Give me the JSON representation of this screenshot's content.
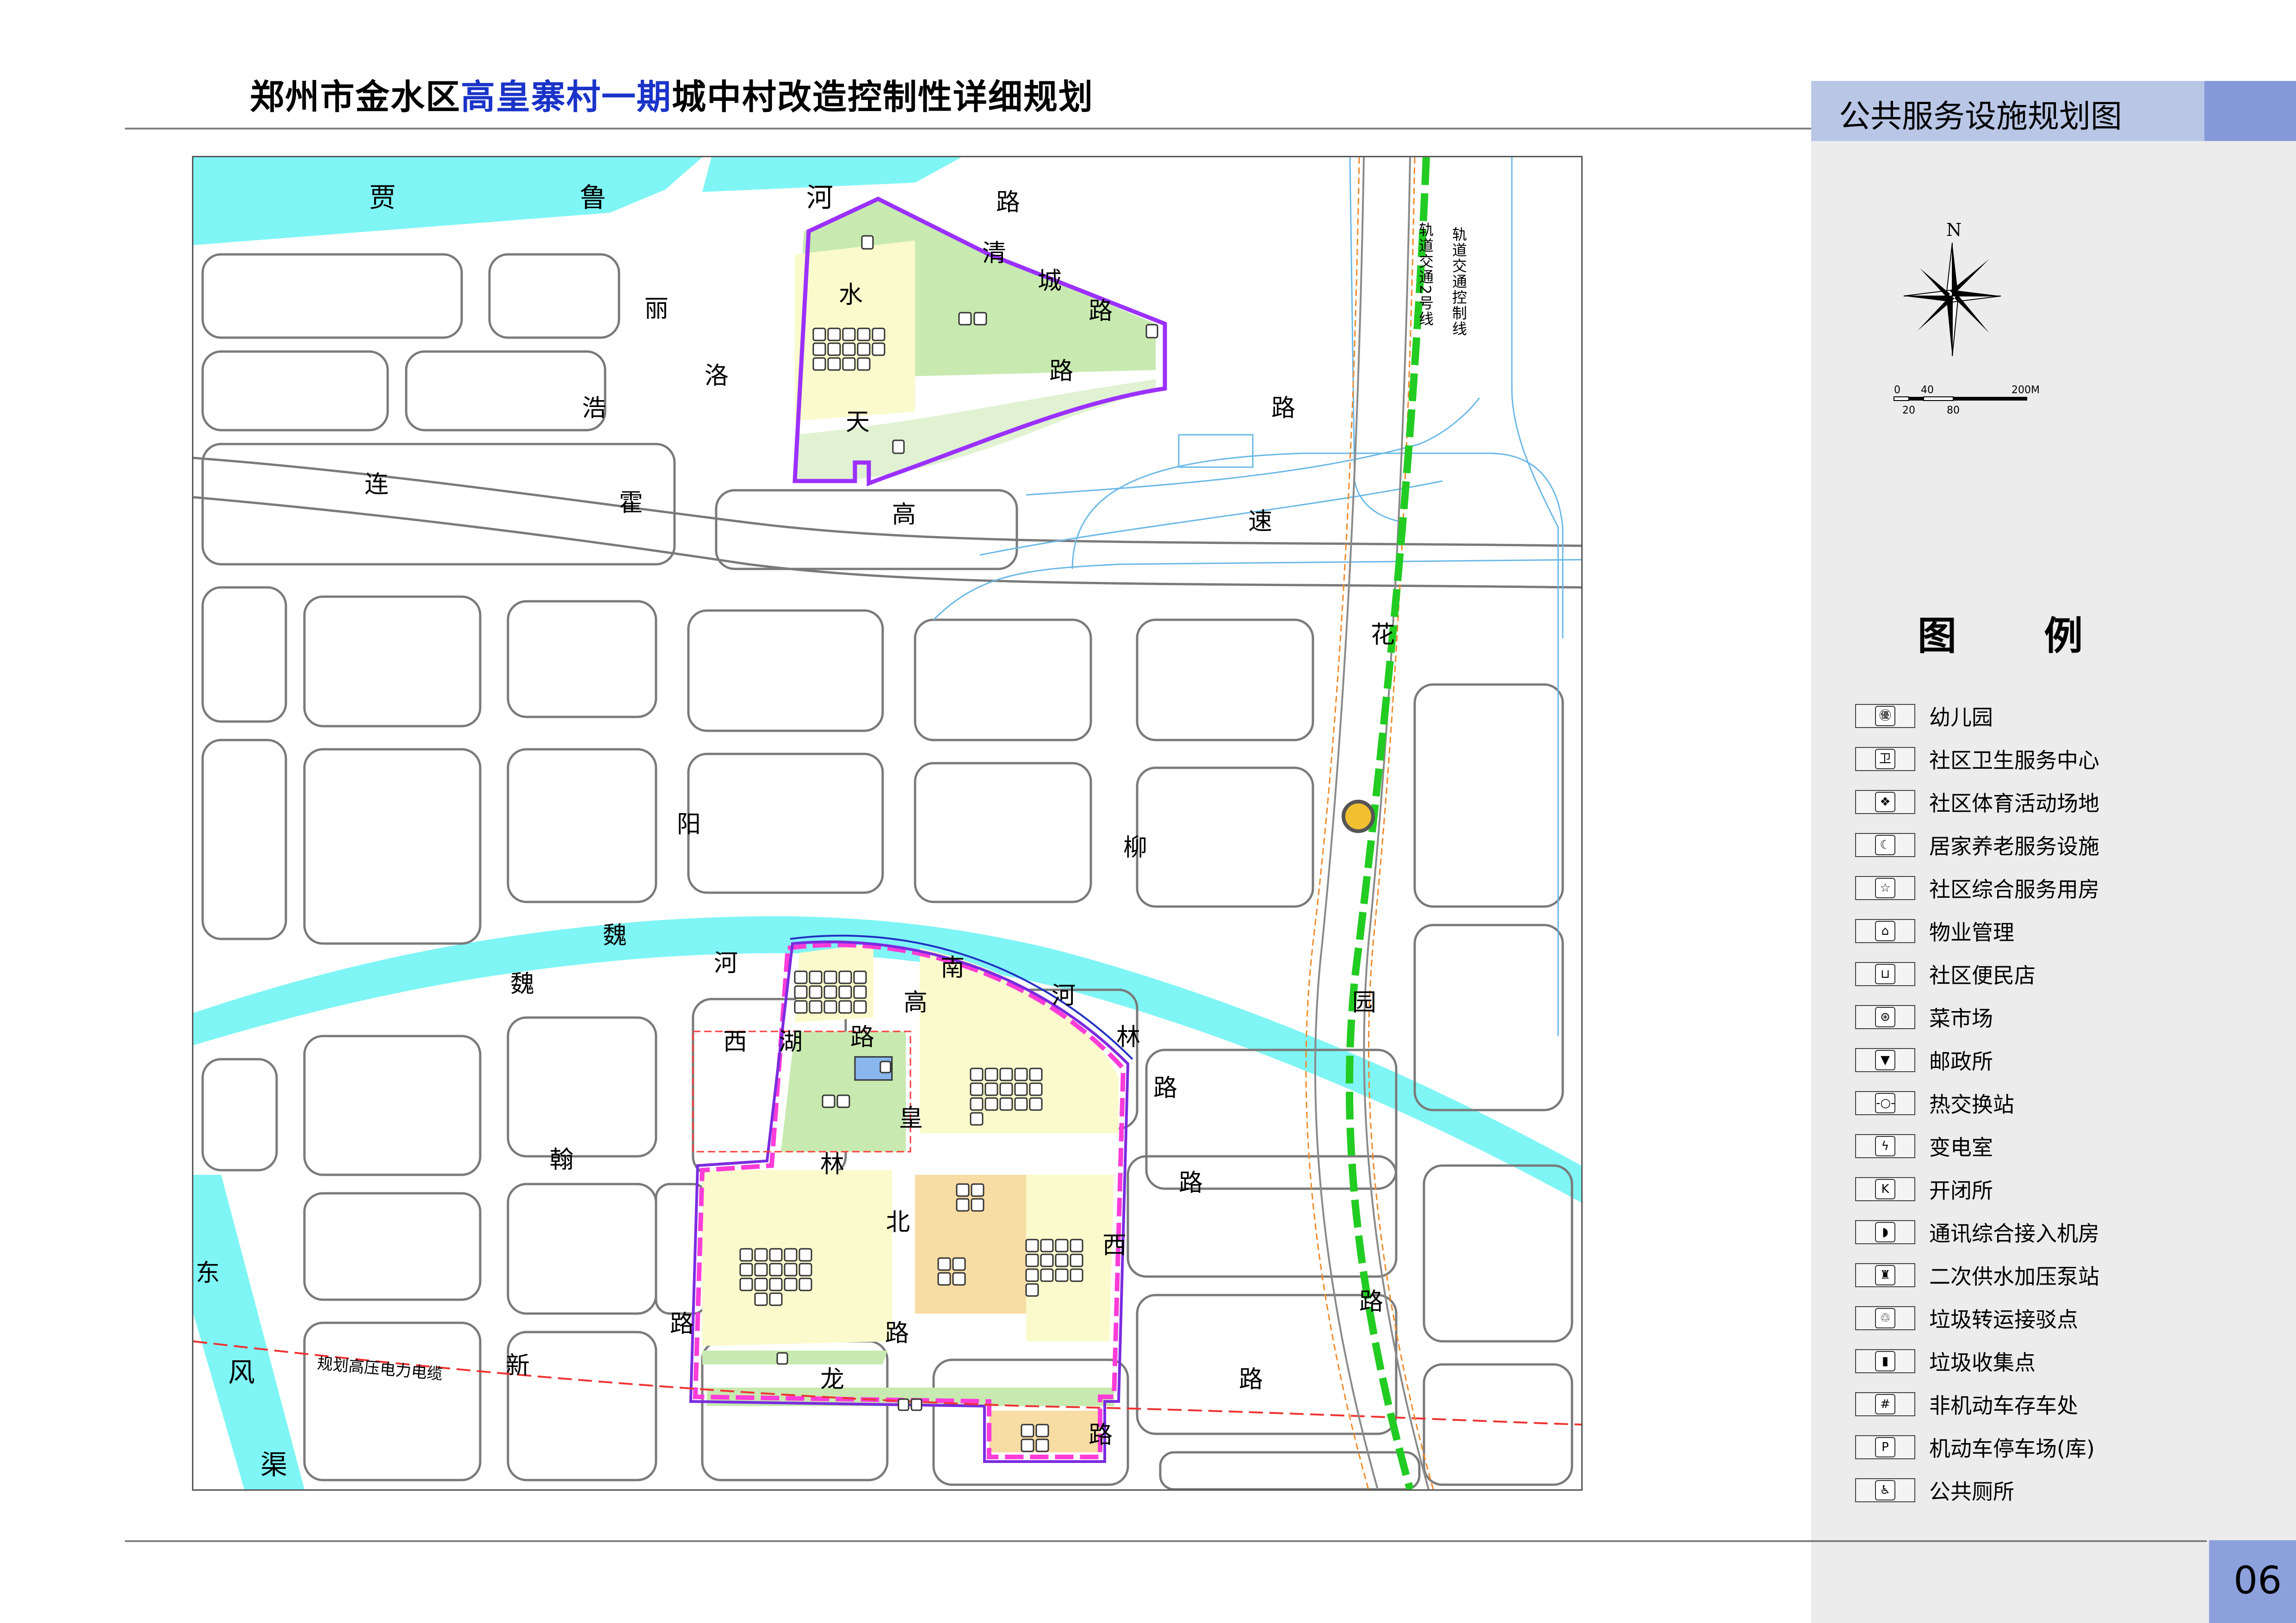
{
  "title": {
    "part1": "郑州市金水区",
    "part2": "高皇寨村一期",
    "part3": "城中村改造控制性详细规划"
  },
  "panel_title": "公共服务设施规划图",
  "page_number": "06",
  "compass": {
    "north": "N"
  },
  "scale": {
    "top": [
      "0",
      "40",
      "200M"
    ],
    "bottom": [
      "20",
      "80"
    ]
  },
  "legend": {
    "title": "图 例",
    "items": [
      {
        "icon": "㊝",
        "label": "幼儿园"
      },
      {
        "icon": "卫",
        "label": "社区卫生服务中心"
      },
      {
        "icon": "❖",
        "label": "社区体育活动场地"
      },
      {
        "icon": "☾",
        "label": "居家养老服务设施"
      },
      {
        "icon": "☆",
        "label": "社区综合服务用房"
      },
      {
        "icon": "⌂",
        "label": "物业管理"
      },
      {
        "icon": "⊔",
        "label": "社区便民店"
      },
      {
        "icon": "⊛",
        "label": "菜市场"
      },
      {
        "icon": "▼",
        "label": "邮政所"
      },
      {
        "icon": "-○-",
        "label": "热交换站"
      },
      {
        "icon": "ϟ",
        "label": "变电室"
      },
      {
        "icon": "K",
        "label": "开闭所"
      },
      {
        "icon": "◗",
        "label": "通讯综合接入机房"
      },
      {
        "icon": "♜",
        "label": "二次供水加压泵站"
      },
      {
        "icon": "♲",
        "label": "垃圾转运接驳点"
      },
      {
        "icon": "▮",
        "label": "垃圾收集点"
      },
      {
        "icon": "#",
        "label": "非机动车存车处"
      },
      {
        "icon": "P",
        "label": "机动车停车场(库)"
      },
      {
        "icon": "♿",
        "label": "公共厕所"
      }
    ]
  },
  "map": {
    "rail_labels": [
      "轨道交通2号线",
      "轨道交通控制线"
    ],
    "hv_cable": "规划高压电力电缆",
    "road_chars": [
      {
        "t": "贾"
      },
      {
        "t": "鲁"
      },
      {
        "t": "河"
      },
      {
        "t": "路"
      },
      {
        "t": "清"
      },
      {
        "t": "城"
      },
      {
        "t": "路"
      },
      {
        "t": "水"
      },
      {
        "t": "丽"
      },
      {
        "t": "路"
      },
      {
        "t": "洛"
      },
      {
        "t": "浩"
      },
      {
        "t": "天"
      },
      {
        "t": "路"
      },
      {
        "t": "连"
      },
      {
        "t": "霍"
      },
      {
        "t": "高"
      },
      {
        "t": "速"
      },
      {
        "t": "花"
      },
      {
        "t": "阳"
      },
      {
        "t": "柳"
      },
      {
        "t": "魏"
      },
      {
        "t": "河"
      },
      {
        "t": "魏"
      },
      {
        "t": "南"
      },
      {
        "t": "高"
      },
      {
        "t": "河"
      },
      {
        "t": "西"
      },
      {
        "t": "湖"
      },
      {
        "t": "路"
      },
      {
        "t": "林"
      },
      {
        "t": "园"
      },
      {
        "t": "路"
      },
      {
        "t": "皇"
      },
      {
        "t": "翰"
      },
      {
        "t": "林"
      },
      {
        "t": "路"
      },
      {
        "t": "北"
      },
      {
        "t": "西"
      },
      {
        "t": "东"
      },
      {
        "t": "路"
      },
      {
        "t": "路"
      },
      {
        "t": "路"
      },
      {
        "t": "新"
      },
      {
        "t": "龙"
      },
      {
        "t": "路"
      },
      {
        "t": "风"
      },
      {
        "t": "路"
      },
      {
        "t": "渠"
      }
    ]
  },
  "colors": {
    "water": "#7ff5f5",
    "green": "#c8eab0",
    "residential": "#fafacc",
    "commercial": "#f7dca3",
    "boundary": "#9b30ff",
    "rail": "#22cc22",
    "road_line": "#777777"
  }
}
